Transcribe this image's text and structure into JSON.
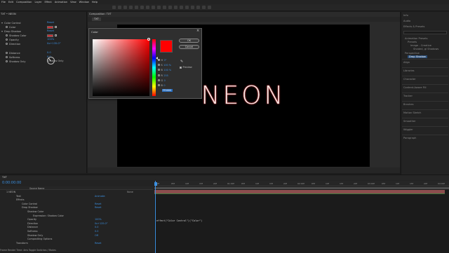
{
  "menubar": [
    "File",
    "Edit",
    "Composition",
    "Layer",
    "Effect",
    "Animation",
    "View",
    "Window",
    "Help"
  ],
  "effect_controls": {
    "tab": "TXT • NEON",
    "rows": [
      {
        "label": "Color Control",
        "value": "Reset"
      },
      {
        "label": "Color",
        "value": ""
      },
      {
        "label": "Drop Shadow",
        "value": "Reset"
      },
      {
        "label": "Shadow Color",
        "value": ""
      },
      {
        "label": "Opacity",
        "value": "100%"
      },
      {
        "label": "Direction",
        "value": "0x+135.0°"
      },
      {
        "label": "Distance",
        "value": "0.0"
      },
      {
        "label": "Softness",
        "value": "0.0"
      },
      {
        "label": "Shadow Only",
        "value": "Shadow Only"
      }
    ]
  },
  "composition": {
    "tab": "Composition: TXT",
    "subtab": "TXT",
    "canvas_text": "NEON"
  },
  "right_panel": {
    "items": [
      "Info",
      "Audio",
      "Effects & Presets",
      "Animation Presets",
      "Presets",
      "Image - Creative",
      "Shaded, gl Shadows",
      "Perspective",
      "Drop Shadow",
      "Align",
      "Libraries",
      "Character",
      "Content-Aware Fill",
      "Tracker",
      "Brushes",
      "Motion Sketch",
      "Smoother",
      "Wiggler",
      "Paragraph"
    ],
    "search_placeholder": ""
  },
  "color_dialog": {
    "title": "Color",
    "close": "×",
    "ok": "OK",
    "cancel": "Cancel",
    "fields": [
      {
        "label": "H",
        "value": "0°"
      },
      {
        "label": "S",
        "value": "100 %"
      },
      {
        "label": "B",
        "value": "100 %"
      },
      {
        "label": "R",
        "value": "255"
      },
      {
        "label": "G",
        "value": "0"
      },
      {
        "label": "B",
        "value": "0"
      }
    ],
    "hex": "FF0000",
    "preview_label": "Preview"
  },
  "timeline": {
    "tab": "TXT",
    "timecode": "0:00:00:00",
    "column_header": "Source Name",
    "rows": [
      {
        "label": "1   NEON",
        "value": "",
        "value2": "None",
        "indent": 3
      },
      {
        "label": "Text",
        "value": "Animate:",
        "value2": "",
        "indent": 10
      },
      {
        "label": "Effects",
        "value": "",
        "value2": "",
        "indent": 10
      },
      {
        "label": "Color Control",
        "value": "Reset",
        "value2": "",
        "indent": 14
      },
      {
        "label": "Drop Shadow",
        "value": "Reset",
        "value2": "",
        "indent": 14
      },
      {
        "label": "Shadow Color",
        "value": "",
        "value2": "",
        "indent": 18
      },
      {
        "label": "Expression: Shadow Color",
        "value": "",
        "value2": "",
        "indent": 22
      },
      {
        "label": "Opacity",
        "value": "100%",
        "value2": "",
        "indent": 18
      },
      {
        "label": "Direction",
        "value": "0x+135.0°",
        "value2": "",
        "indent": 18
      },
      {
        "label": "Distance",
        "value": "0.0",
        "value2": "",
        "indent": 18
      },
      {
        "label": "Softness",
        "value": "0.0",
        "value2": "",
        "indent": 18
      },
      {
        "label": "Shadow Only",
        "value": "Off",
        "value2": "",
        "indent": 18
      },
      {
        "label": "Compositing Options",
        "value": "",
        "value2": "",
        "indent": 18
      },
      {
        "label": "Transform",
        "value": "Reset",
        "value2": "",
        "indent": 10
      }
    ],
    "ruler_ticks": [
      "0f",
      "05f",
      "10f",
      "15f",
      "20f",
      "01:00f",
      "05f",
      "10f",
      "15f",
      "20f",
      "02:00f",
      "05f",
      "10f",
      "15f",
      "20f",
      "03:00f",
      "05f",
      "10f",
      "15f",
      "20f",
      "04:00f"
    ],
    "expression": "effect(\"Color Control\")(\"Color\")",
    "footer": "Frame Render Time: 4ms          Toggle Switches / Modes"
  },
  "colors": {
    "accent": "#3b8fe0",
    "swatch": "#d12a30",
    "selected_color": "#ff0000"
  }
}
